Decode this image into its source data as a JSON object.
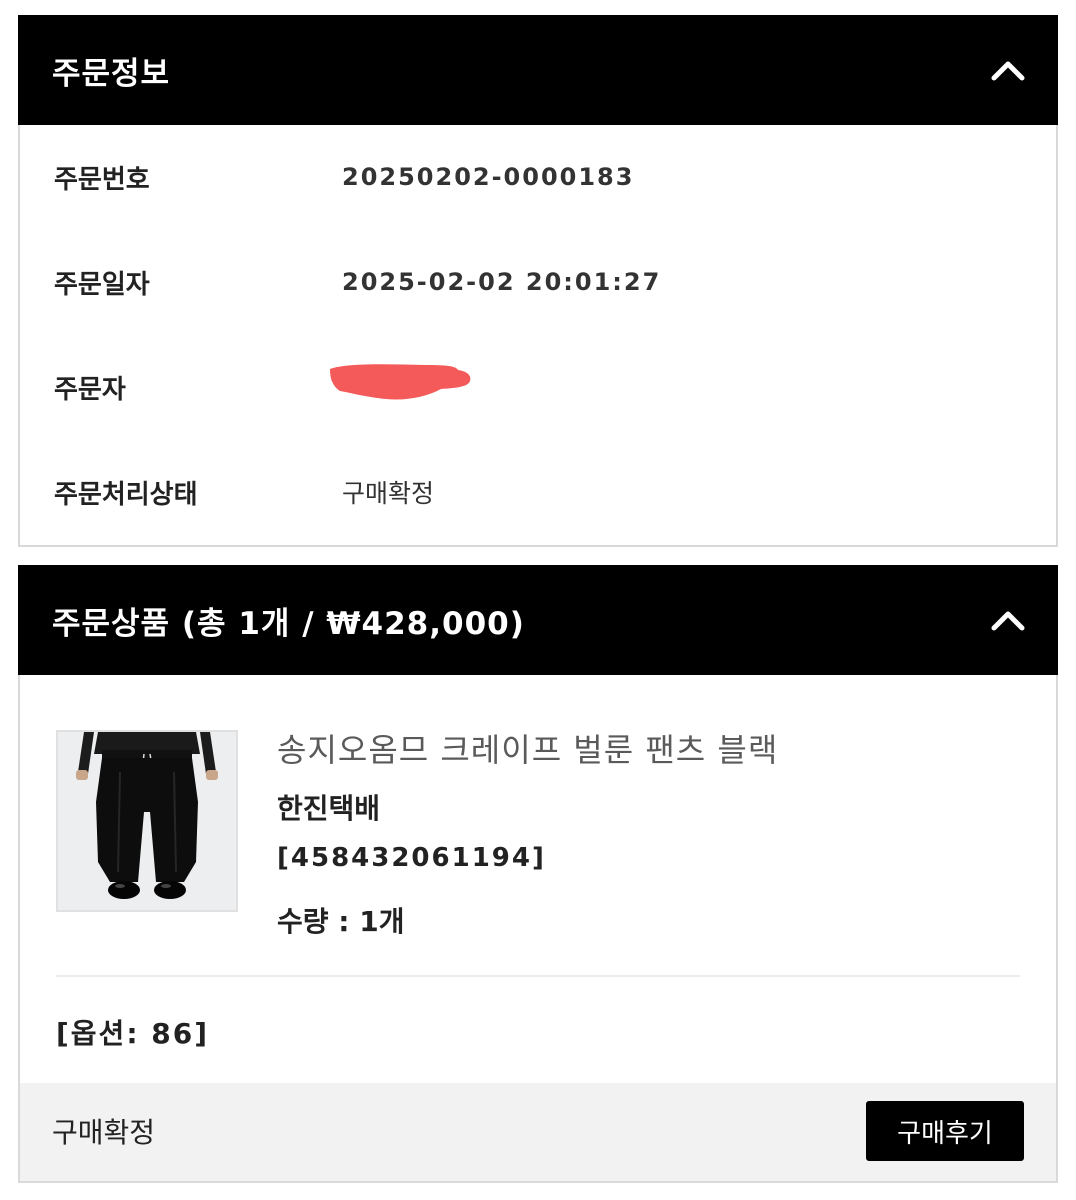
{
  "order_info": {
    "title": "주문정보",
    "rows": [
      {
        "label": "주문번호",
        "value": "20250202-0000183"
      },
      {
        "label": "주문일자",
        "value": "2025-02-02 20:01:27"
      },
      {
        "label": "주문자",
        "value": ""
      },
      {
        "label": "주문처리상태",
        "value": "구매확정"
      }
    ],
    "redaction_color": "#f55a5a"
  },
  "order_items": {
    "title": "주문상품 (총 1개 / ₩428,000)",
    "product": {
      "image": "black-pants-photo",
      "name": "송지오옴므 크레이프 벌룬 팬츠 블랙",
      "courier": "한진택배",
      "tracking": "[458432061194]",
      "quantity": "수량 : 1개",
      "option": "[옵션: 86]"
    },
    "footer": {
      "status": "구매확정",
      "review_button": "구매후기"
    }
  },
  "icons": {
    "collapse": "chevron-up-icon"
  }
}
